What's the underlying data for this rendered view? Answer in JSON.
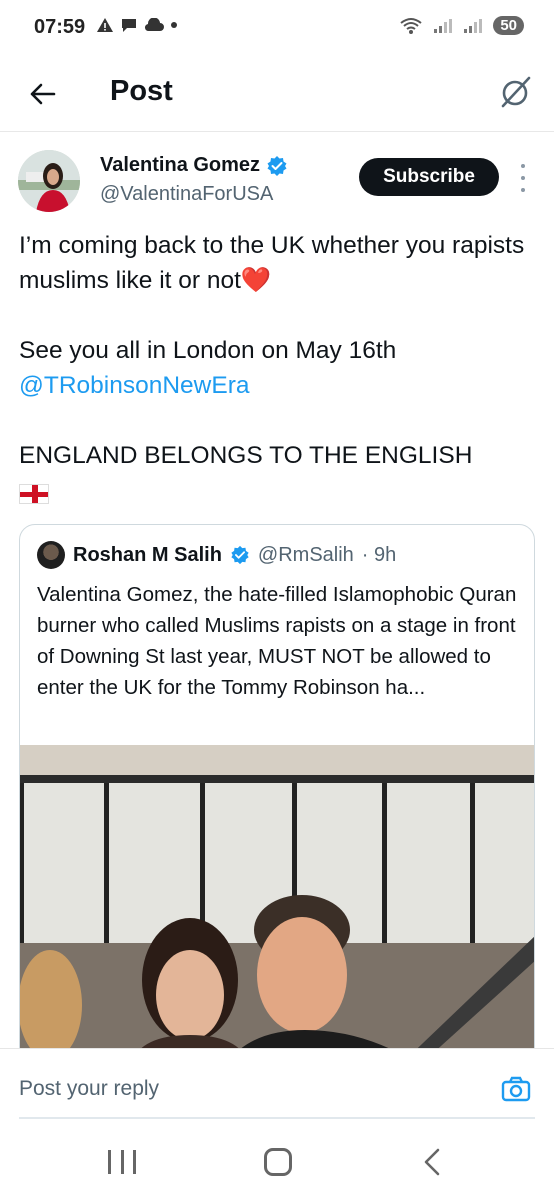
{
  "status_bar": {
    "time": "07:59",
    "battery": "50"
  },
  "header": {
    "title": "Post"
  },
  "post": {
    "author": {
      "name": "Valentina Gomez",
      "handle": "@ValentinaForUSA",
      "verified": true
    },
    "subscribe_label": "Subscribe",
    "text": {
      "line1": "I’m coming back to the UK whether you rapists muslims like it or not",
      "heart": "❤️",
      "line2": "See you all in London on May 16th",
      "mention": "@TRobinsonNewEra",
      "line3": "ENGLAND BELONGS TO THE ENGLISH"
    }
  },
  "quoted_post": {
    "author": {
      "name": "Roshan M Salih",
      "handle": "@RmSalih",
      "time": "· 9h",
      "verified": true
    },
    "text": "Valentina Gomez, the hate-filled Islamophobic Quran burner who called Muslims rapists on a stage in front of Downing St last year, MUST NOT be allowed to enter the UK for the Tommy Robinson ha..."
  },
  "reply": {
    "placeholder": "Post your reply"
  },
  "colors": {
    "accent": "#1d9bf0",
    "text_primary": "#0f1419",
    "text_secondary": "#536471",
    "button_dark": "#0f1419"
  },
  "icons": {
    "back": "arrow-left-icon",
    "grok": "grok-icon",
    "verified": "verified-badge-icon",
    "more": "more-vertical-icon",
    "camera": "camera-icon"
  }
}
